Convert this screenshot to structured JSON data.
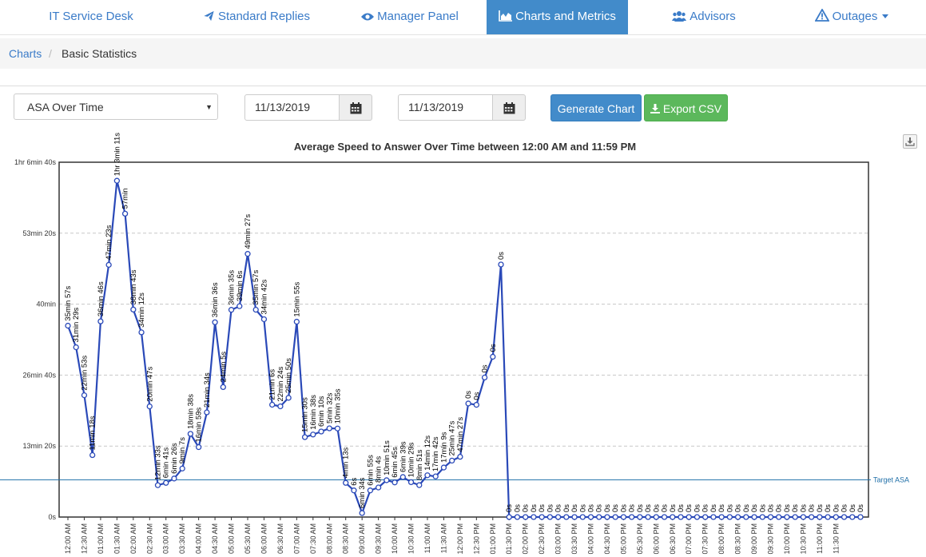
{
  "nav": {
    "items": [
      {
        "label": "IT Service Desk",
        "icon": "none"
      },
      {
        "label": "Standard Replies",
        "icon": "paper-plane-icon"
      },
      {
        "label": "Manager Panel",
        "icon": "eye-icon"
      },
      {
        "label": "Charts and Metrics",
        "icon": "area-chart-icon",
        "active": true
      },
      {
        "label": "Advisors",
        "icon": "users-icon"
      },
      {
        "label": "Outages",
        "icon": "warning-icon",
        "dropdown": true
      }
    ]
  },
  "breadcrumb": {
    "parent": "Charts",
    "separator": "/",
    "current": "Basic Statistics"
  },
  "toolbar": {
    "chart_select": "ASA Over Time",
    "start_date": "11/13/2019",
    "end_date": "11/13/2019",
    "generate_label": "Generate Chart",
    "export_label": "Export CSV"
  },
  "colors": {
    "accent": "#428bca",
    "success": "#5cb85c",
    "series": "#2a49b8",
    "target": "#1f6fa8"
  },
  "chart_data": {
    "type": "line",
    "title": "Average Speed to Answer Over Time between 12:00 AM and 11:59 PM",
    "y_unit": "seconds",
    "ylim": [
      0,
      4000
    ],
    "y_ticks": [
      0,
      800,
      1600,
      2400,
      3200,
      4000
    ],
    "y_tick_labels": [
      "0s",
      "13min 20s",
      "26min 40s",
      "40min",
      "53min 20s",
      "1hr 6min 40s"
    ],
    "grid": true,
    "x_tick_labels": [
      "12:00 AM",
      "12:30 AM",
      "01:00 AM",
      "01:30 AM",
      "02:00 AM",
      "02:30 AM",
      "03:00 AM",
      "03:30 AM",
      "04:00 AM",
      "04:30 AM",
      "05:00 AM",
      "05:30 AM",
      "06:00 AM",
      "06:30 AM",
      "07:00 AM",
      "07:30 AM",
      "08:00 AM",
      "08:30 AM",
      "09:00 AM",
      "09:30 AM",
      "10:00 AM",
      "10:30 AM",
      "11:00 AM",
      "11:30 AM",
      "12:00 PM",
      "12:30 PM",
      "01:00 PM",
      "01:30 PM",
      "02:00 PM",
      "02:30 PM",
      "03:00 PM",
      "03:30 PM",
      "04:00 PM",
      "04:30 PM",
      "05:00 PM",
      "05:30 PM",
      "06:00 PM",
      "06:30 PM",
      "07:00 PM",
      "07:30 PM",
      "08:00 PM",
      "08:30 PM",
      "09:00 PM",
      "09:30 PM",
      "10:00 PM",
      "10:30 PM",
      "11:00 PM",
      "11:30 PM"
    ],
    "series": [
      {
        "values": [
          2157,
          1914,
          1373,
          698,
          2206,
          2843,
          3791,
          3420,
          2339,
          2082,
          1247,
          359,
          385,
          434,
          547,
          938,
          788,
          1180,
          2196,
          1465,
          2336,
          2377,
          2967,
          2337,
          2230,
          1266,
          1248,
          1344,
          2202,
          901,
          930,
          964,
          1000,
          998,
          385,
          300,
          45,
          300,
          333,
          415,
          390,
          451,
          393,
          360,
          471,
          458,
          558,
          636,
          679,
          1280,
          1265,
          1573,
          1807,
          2847,
          0,
          0,
          0,
          0,
          0,
          0,
          0,
          0,
          0,
          0,
          0,
          0,
          0,
          0,
          0,
          0,
          0,
          0,
          0,
          0,
          0,
          0,
          0,
          0,
          0,
          0,
          0,
          0,
          0,
          0,
          0,
          0,
          0,
          0,
          0,
          0,
          0,
          0,
          0,
          0,
          0,
          0,
          0,
          0
        ],
        "labels": [
          "35min 57s",
          "31min 29s",
          "22min 53s",
          "11min 18s",
          "36min 46s",
          "47min 23s",
          "1hr 3min 11s",
          "57min",
          "38min 43s",
          "34min 12s",
          "20min 47s",
          "12min 33s",
          "6min 41s",
          "6min 26s",
          "9min 7s",
          "18min 38s",
          "16min 59s",
          "21min 34s",
          "36min 36s",
          "24min 5s",
          "36min 35s",
          "39min 6s",
          "49min 27s",
          "35min 57s",
          "34min 42s",
          "21min 6s",
          "22min 24s",
          "25min 50s",
          "15min 55s",
          "15min 30s",
          "16min 38s",
          "6min 10s",
          "5min 32s",
          "10min 35s",
          "4min 13s",
          "6s",
          "6min 34s",
          "6min 55s",
          "8min 4s",
          "10min 51s",
          "6min 45s",
          "6min 39s",
          "10min 29s",
          "8min 51s",
          "14min 12s",
          "17min 42s",
          "17min 9s",
          "25min 47s",
          "47min 27s",
          "0s"
        ]
      }
    ],
    "target_line": {
      "label": "Target ASA",
      "value": 420
    }
  }
}
